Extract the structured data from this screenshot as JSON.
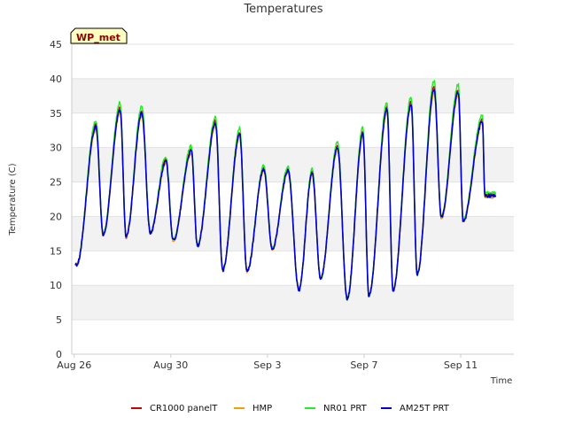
{
  "chart_data": {
    "type": "line",
    "title": "Temperatures",
    "xlabel": "Time",
    "ylabel": "Temperature (C)",
    "station_badge": "WP_met",
    "x_unit": "date",
    "x_start": "2023-08-26",
    "xlim_days": [
      -0.1,
      18.2
    ],
    "x_ticks": [
      {
        "label": "Aug 26",
        "day": 0
      },
      {
        "label": "Aug 30",
        "day": 4
      },
      {
        "label": "Sep 3",
        "day": 8
      },
      {
        "label": "Sep 7",
        "day": 12
      },
      {
        "label": "Sep 11",
        "day": 16
      }
    ],
    "ylim": [
      0,
      45
    ],
    "y_ticks": [
      0,
      5,
      10,
      15,
      20,
      25,
      30,
      35,
      40,
      45
    ],
    "grid": "horizontal bands",
    "legend_position": "bottom",
    "daily_extremes": {
      "min_day": [
        0.1,
        1.2,
        2.15,
        3.15,
        4.1,
        5.1,
        6.15,
        7.15,
        8.2,
        9.3,
        10.2,
        11.3,
        12.2,
        13.2,
        14.2,
        15.2,
        16.1,
        17.0
      ],
      "min_temp": [
        13.0,
        17.3,
        17.0,
        17.6,
        16.5,
        15.7,
        12.2,
        12.0,
        15.3,
        9.3,
        11.0,
        8.0,
        8.5,
        9.3,
        11.6,
        19.8,
        19.3,
        23.0
      ],
      "max_day": [
        0.9,
        1.9,
        2.8,
        3.8,
        4.85,
        5.85,
        6.85,
        7.85,
        8.85,
        9.85,
        10.9,
        11.95,
        12.95,
        13.95,
        14.9,
        15.9,
        16.9
      ],
      "max_temp": [
        33.0,
        35.5,
        35.0,
        28.0,
        29.5,
        33.5,
        32.0,
        26.8,
        26.6,
        26.3,
        30.0,
        32.0,
        35.5,
        36.3,
        38.5,
        38.0,
        33.8
      ]
    },
    "series": [
      {
        "name": "CR1000 panelT",
        "color": "#cc0000",
        "offset": 0.4
      },
      {
        "name": "HMP",
        "color": "#f0a000",
        "offset": -0.5
      },
      {
        "name": "NR01 PRT",
        "color": "#22ee22",
        "offset": 1.3
      },
      {
        "name": "AM25T PRT",
        "color": "#0000cc",
        "offset": 0
      }
    ]
  }
}
